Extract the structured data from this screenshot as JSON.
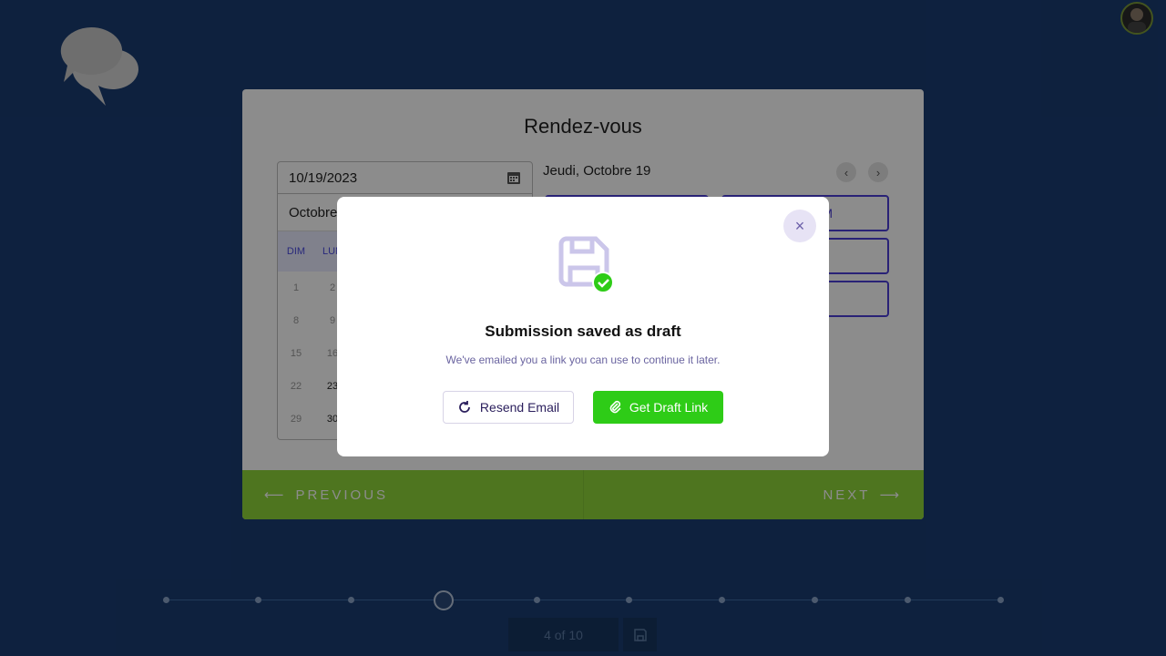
{
  "card": {
    "title": "Rendez-vous",
    "date_value": "10/19/2023",
    "calendar": {
      "month_label": "Octobre",
      "day_names": [
        "DIM",
        "LUN"
      ],
      "rows": [
        [
          "1",
          "2"
        ],
        [
          "8",
          "9"
        ],
        [
          "15",
          "16"
        ],
        [
          "22",
          "23"
        ],
        [
          "29",
          "30"
        ]
      ]
    },
    "day_title": "Jeudi, Octobre 19",
    "slot_label": "M",
    "previous_label": "PREVIOUS",
    "next_label": "NEXT"
  },
  "progress": {
    "page_label": "4 of 10",
    "total_steps": 10,
    "current_step": 4
  },
  "modal": {
    "title": "Submission saved as draft",
    "subtitle": "We've emailed you a link you can use to continue it later.",
    "resend_label": "Resend Email",
    "draft_link_label": "Get Draft Link",
    "close_glyph": "×"
  },
  "colors": {
    "background": "#1a3d72",
    "accent_green": "#2ecc17",
    "footer_green": "#8ed63a",
    "slot_purple": "#4b3fd8"
  },
  "icons": {
    "logo": "chat-bubbles-icon",
    "calendar": "calendar-icon",
    "modal": "floppy-disk-check-icon",
    "resend": "refresh-icon",
    "draft": "paperclip-icon",
    "save": "save-icon"
  }
}
